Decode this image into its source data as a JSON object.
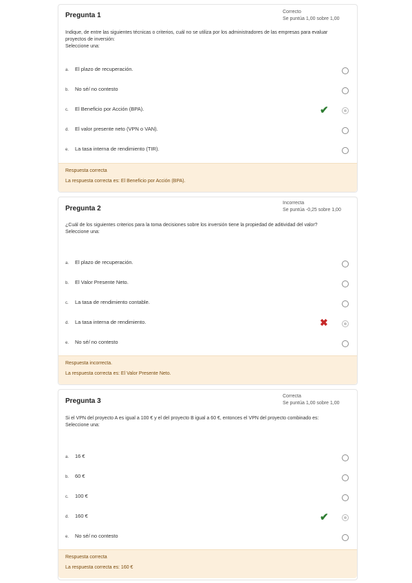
{
  "questions": [
    {
      "title": "Pregunta 1",
      "status": "Correcto",
      "score": "Se puntúa 1,00 sobre 1,00",
      "text": "Indique, de entre las siguientes técnicas o criterios, cuál no se utiliza por los administradores de las empresas para evaluar proyectos de inversión:",
      "select_label": "Seleccione una:",
      "options": [
        {
          "letter": "a.",
          "text": "El plazo de recuperación."
        },
        {
          "letter": "b.",
          "text": "No sé/ no contesto"
        },
        {
          "letter": "c.",
          "text": "El Beneficio por Acción (BPA)."
        },
        {
          "letter": "d.",
          "text": "El valor presente neto (VPN o VAN)."
        },
        {
          "letter": "e.",
          "text": "La tasa interna de rendimiento (TIR)."
        }
      ],
      "feedback_title": "Respuesta correcta",
      "feedback_answer": "La respuesta correcta es: El Beneficio por Acción (BPA)."
    },
    {
      "title": "Pregunta 2",
      "status": "Incorrecta",
      "score": "Se puntúa -0,25 sobre 1,00",
      "text": "¿Cuál de los siguientes criterios para la toma decisiones sobre los inversión tiene la propiedad de aditividad del valor?",
      "select_label": "Seleccione una:",
      "options": [
        {
          "letter": "a.",
          "text": "El plazo de recuperación."
        },
        {
          "letter": "b.",
          "text": "El Valor Presente Neto."
        },
        {
          "letter": "c.",
          "text": "La tasa de rendimiento contable."
        },
        {
          "letter": "d.",
          "text": "La tasa interna de rendimiento."
        },
        {
          "letter": "e.",
          "text": "No sé/ no contesto"
        }
      ],
      "feedback_title": "Respuesta incorrecta.",
      "feedback_answer": "La respuesta correcta es: El Valor Presente Neto."
    },
    {
      "title": "Pregunta 3",
      "status": "Correcta",
      "score": "Se puntúa 1,00 sobre 1,00",
      "text": "Si el VPN del proyecto A es igual a 100 € y el del proyecto B igual a 60 €, entonces el VPN del proyecto combinado es:",
      "select_label": "Seleccione una:",
      "options": [
        {
          "letter": "a.",
          "text": "16 €"
        },
        {
          "letter": "b.",
          "text": "60 €"
        },
        {
          "letter": "c.",
          "text": "100 €"
        },
        {
          "letter": "d.",
          "text": "160 €"
        },
        {
          "letter": "e.",
          "text": "No sé/ no contesto"
        }
      ],
      "feedback_title": "Respuesta correcta",
      "feedback_answer": "La respuesta correcta es: 160 €"
    }
  ],
  "icons": {
    "correct": "check-icon",
    "incorrect": "cross-icon",
    "correct_color": "#2e7d32",
    "incorrect_color": "#c62828",
    "feedback_bg": "#fcefdc"
  }
}
